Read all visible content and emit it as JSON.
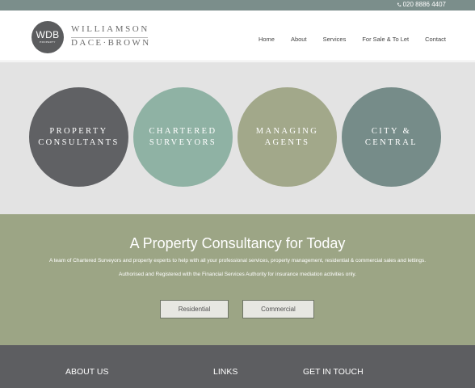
{
  "topbar": {
    "phone_icon": "phone-icon",
    "phone": "020 8886 4407"
  },
  "logo": {
    "badge_text": "WDB",
    "badge_sub": "PROPERTY",
    "name_line1": "WILLIAMSON",
    "name_line2": "DACE·BROWN"
  },
  "nav": {
    "items": [
      {
        "label": "Home"
      },
      {
        "label": "About"
      },
      {
        "label": "Services"
      },
      {
        "label": "For Sale & To Let"
      },
      {
        "label": "Contact"
      }
    ]
  },
  "circles": [
    {
      "line1": "PROPERTY",
      "line2": "CONSULTANTS",
      "color": "#606164"
    },
    {
      "line1": "CHARTERED",
      "line2": "SURVEYORS",
      "color": "#8fb2a4"
    },
    {
      "line1": "MANAGING",
      "line2": "AGENTS",
      "color": "#a2a88a"
    },
    {
      "line1": "CITY &",
      "line2": "CENTRAL",
      "color": "#768c89"
    }
  ],
  "hero": {
    "title": "A Property Consultancy for Today",
    "text1": "A team of Chartered Surveyors and property experts to help with all your professional services, property management, residential & commercial sales and lettings.",
    "text2": "Authorised and Registered with the Financial Services Authority for insurance mediation activities only.",
    "buttons": {
      "residential": "Residential",
      "commercial": "Commercial"
    },
    "bg_color": "#9ca585"
  },
  "footer": {
    "about": "ABOUT US",
    "links": "LINKS",
    "touch": "GET IN TOUCH",
    "bg_color": "#5d5e61"
  }
}
